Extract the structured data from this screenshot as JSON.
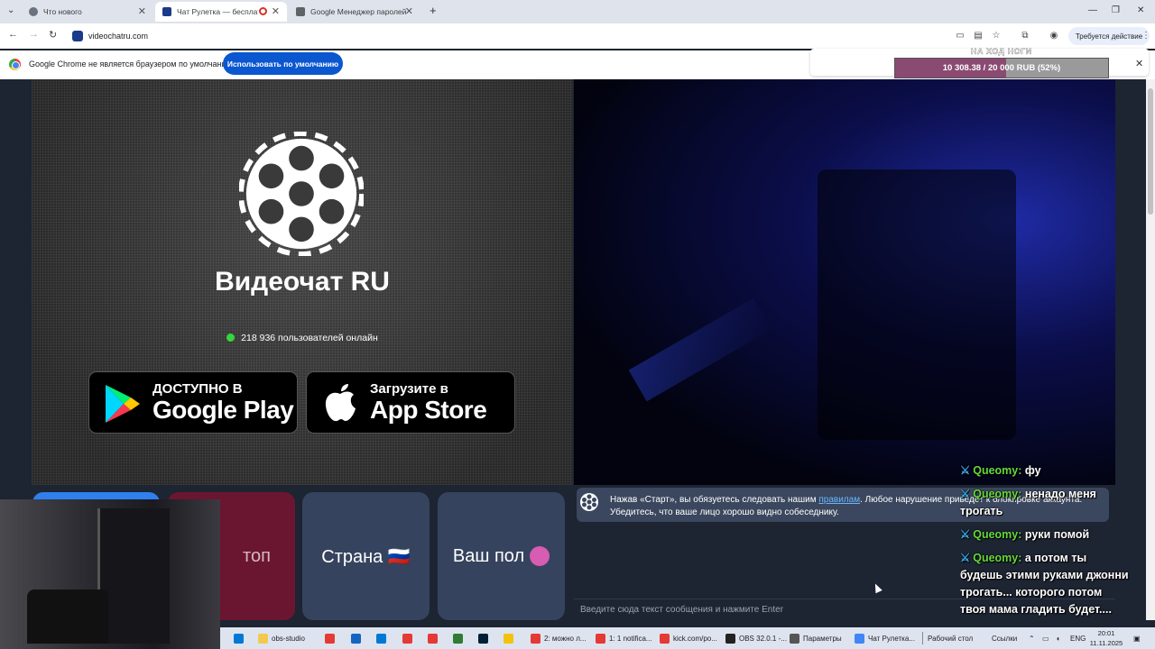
{
  "browser": {
    "tabs": [
      {
        "title": "Что нового",
        "color": "#6b7280"
      },
      {
        "title": "Чат Рулетка — бесплатный",
        "color": "#1a3b8a"
      },
      {
        "title": "Google Менеджер паролей",
        "color": "#5f6368"
      }
    ],
    "new_tab": "+",
    "url": "videochatru.com",
    "action_label": "Требуется действие"
  },
  "infobar": {
    "message": "Google Chrome не является браузером по умолчанию.",
    "button": "Использовать по умолчанию",
    "close": "✕"
  },
  "donation": {
    "title": "НА ХОД НОГИ",
    "text": "10 308.38 / 20 000 RUB (52%)",
    "progress": 0.52
  },
  "site": {
    "title": "Видеочат RU",
    "online_count": "218 936 пользователей онлайн",
    "google_play_small": "ДОСТУПНО В",
    "google_play_big": "Google Play",
    "app_store_small": "Загрузите в",
    "app_store_big": "App Store",
    "tile_stop": "топ",
    "tile_country": "Страна 🇷🇺",
    "tile_gender": "Ваш пол",
    "notice_before": "Нажав «Старт», вы обязуетесь следовать нашим ",
    "notice_link": "правилам",
    "notice_after": ". Любое нарушение приведёт к блокировке аккаунта. Убедитесь, что ваше лицо хорошо видно собеседнику.",
    "input_placeholder": "Введите сюда текст сообщения и нажмите Enter"
  },
  "stream_chat": [
    {
      "user": "Queomy:",
      "text": "фу"
    },
    {
      "user": "Queomy:",
      "text": "ненадо меня трогать"
    },
    {
      "user": "Queomy:",
      "text": "руки помой"
    },
    {
      "user": "Queomy:",
      "text": "а потом ты будешь этими руками джонни трогать... которого потом твоя мама гладить будет...."
    }
  ],
  "taskbar": {
    "items": [
      {
        "label": "obs-studio",
        "color": "#f2c94c"
      },
      {
        "label": "",
        "color": "#e53935"
      },
      {
        "label": "",
        "color": "#1565c0"
      },
      {
        "label": "",
        "color": "#0078d4"
      },
      {
        "label": "",
        "color": "#e53935"
      },
      {
        "label": "",
        "color": "#e53935"
      },
      {
        "label": "",
        "color": "#2e7d32"
      },
      {
        "label": "",
        "color": "#001e36"
      },
      {
        "label": "",
        "color": "#f4c20d"
      },
      {
        "label": "2: можно л...",
        "color": "#e53935"
      },
      {
        "label": "1: 1 notifica...",
        "color": "#e53935"
      },
      {
        "label": "kick.com/po...",
        "color": "#e53935"
      },
      {
        "label": "OBS 32.0.1 -...",
        "color": "#222222"
      },
      {
        "label": "Параметры",
        "color": "#555555"
      },
      {
        "label": "Чат Рулетка...",
        "color": "#4285f4"
      }
    ],
    "desktop": "Рабочий стол",
    "links": "Ссылки",
    "lang": "ENG",
    "time": "20:01",
    "date": "11.11.2025"
  }
}
